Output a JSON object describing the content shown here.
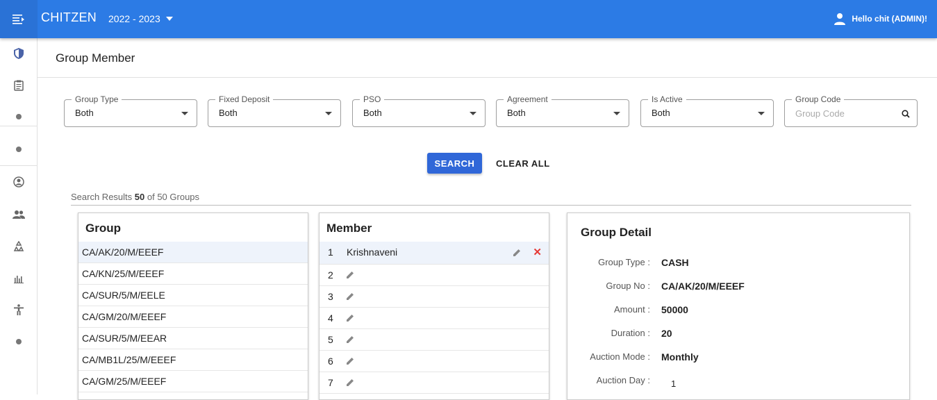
{
  "app": {
    "brand": "CHITZEN",
    "year": "2022 - 2023",
    "user": "Hello chit (ADMIN)!"
  },
  "page": {
    "title": "Group Member"
  },
  "filters": [
    {
      "label": "Group Type",
      "value": "Both"
    },
    {
      "label": "Fixed Deposit",
      "value": "Both"
    },
    {
      "label": "PSO",
      "value": "Both"
    },
    {
      "label": "Agreement",
      "value": "Both"
    },
    {
      "label": "Is Active",
      "value": "Both"
    }
  ],
  "group_code": {
    "label": "Group Code",
    "placeholder": "Group Code"
  },
  "actions": {
    "search": "SEARCH",
    "clear": "CLEAR ALL"
  },
  "results": {
    "prefix": "Search Results",
    "count": "50",
    "suffix": "of 50 Groups"
  },
  "group_panel": {
    "title": "Group",
    "items": [
      "CA/AK/20/M/EEEF",
      "CA/KN/25/M/EEEF",
      "CA/SUR/5/M/EELE",
      "CA/GM/20/M/EEEF",
      "CA/SUR/5/M/EEAR",
      "CA/MB1L/25/M/EEEF",
      "CA/GM/25/M/EEEF"
    ]
  },
  "member_panel": {
    "title": "Member",
    "items": [
      {
        "num": "1",
        "name": "Krishnaveni"
      },
      {
        "num": "2",
        "name": ""
      },
      {
        "num": "3",
        "name": ""
      },
      {
        "num": "4",
        "name": ""
      },
      {
        "num": "5",
        "name": ""
      },
      {
        "num": "6",
        "name": ""
      },
      {
        "num": "7",
        "name": ""
      }
    ]
  },
  "detail_panel": {
    "title": "Group Detail",
    "fields": [
      {
        "key": "Group Type :",
        "value": "CASH"
      },
      {
        "key": "Group No :",
        "value": "CA/AK/20/M/EEEF"
      },
      {
        "key": "Amount :",
        "value": "50000"
      },
      {
        "key": "Duration :",
        "value": "20"
      },
      {
        "key": "Auction Mode :",
        "value": "Monthly"
      },
      {
        "key": "Auction Day :",
        "value": "1"
      }
    ]
  },
  "colors": {
    "primary": "#2c7be5",
    "button": "#3067d8",
    "danger": "#e53935"
  }
}
